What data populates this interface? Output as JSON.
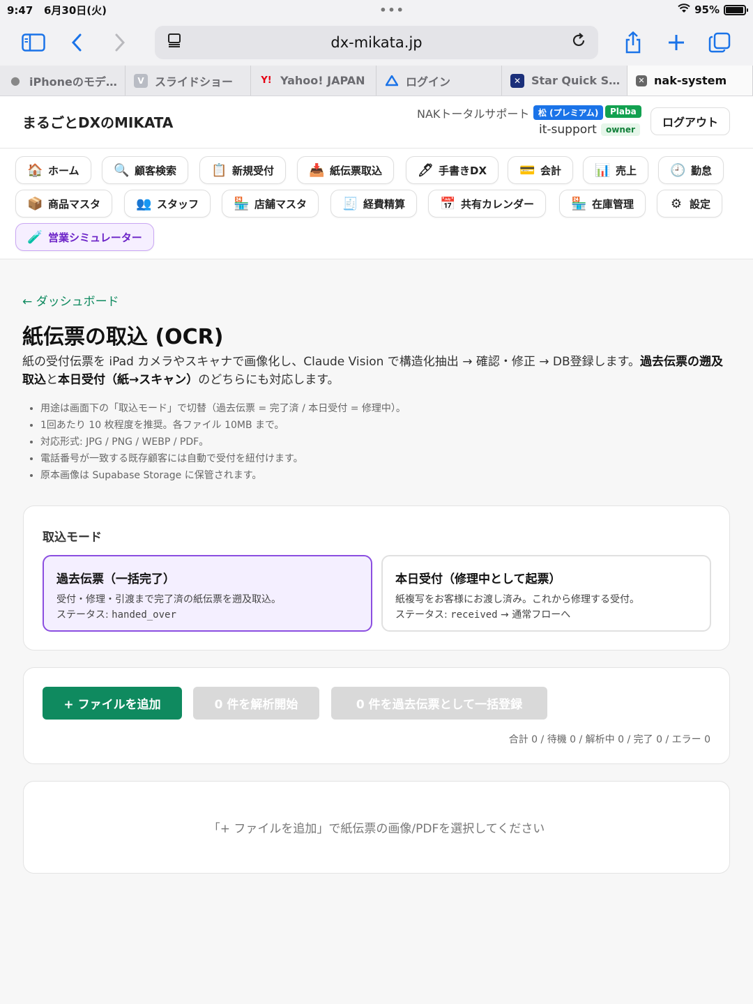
{
  "status_bar": {
    "time": "9:47",
    "date": "6月30日(火)",
    "battery": "95%",
    "battery_level": 0.95
  },
  "browser": {
    "url": "dx-mikata.jp",
    "tabs": [
      {
        "label": "iPhoneのモデ…",
        "icon": "apple-icon"
      },
      {
        "label": "スライドショー",
        "icon": "v-icon"
      },
      {
        "label": "Yahoo! JAPAN",
        "icon": "yahoo-icon"
      },
      {
        "label": "ログイン",
        "icon": "drive-icon"
      },
      {
        "label": "Star Quick S…",
        "icon": "star-icon"
      },
      {
        "label": "nak-system",
        "icon": "close-icon",
        "active": true
      }
    ]
  },
  "header": {
    "brand": "まるごとDXのMIKATA",
    "org": "NAKトータルサポート",
    "plan_badge": "松 (プレミアム)",
    "plaba_badge": "Plaba",
    "user": "it-support",
    "role_badge": "owner",
    "logout": "ログアウト"
  },
  "nav": [
    {
      "label": "ホーム",
      "icon": "🏠"
    },
    {
      "label": "顧客検索",
      "icon": "🔍"
    },
    {
      "label": "新規受付",
      "icon": "📋"
    },
    {
      "label": "紙伝票取込",
      "icon": "📥"
    },
    {
      "label": "手書きDX",
      "icon": "🖊"
    },
    {
      "label": "会計",
      "icon": "💳"
    },
    {
      "label": "売上",
      "icon": "📊"
    },
    {
      "label": "勤怠",
      "icon": "🕘"
    },
    {
      "label": "商品マスタ",
      "icon": "📦"
    },
    {
      "label": "スタッフ",
      "icon": "👥"
    },
    {
      "label": "店舗マスタ",
      "icon": "🏪"
    },
    {
      "label": "経費精算",
      "icon": "🧾"
    },
    {
      "label": "共有カレンダー",
      "icon": "📅"
    },
    {
      "label": "在庫管理",
      "icon": "🏪"
    },
    {
      "label": "設定",
      "icon": "⚙"
    },
    {
      "label": "営業シミュレーター",
      "icon": "🧪"
    }
  ],
  "main": {
    "back_link": "← ダッシュボード",
    "title": "紙伝票の取込 (OCR)",
    "lead_1": "紙の受付伝票を iPad カメラやスキャナで画像化し、Claude Vision で構造化抽出 → 確認・修正 → DB登録します。",
    "lead_2": "過去伝票の遡及取込",
    "lead_3": "と",
    "lead_4": "本日受付（紙→スキャン）",
    "lead_5": "のどちらにも対応します。",
    "notes": [
      "用途は画面下の「取込モード」で切替（過去伝票 = 完了済 / 本日受付 = 修理中）。",
      "1回あたり 10 枚程度を推奨。各ファイル 10MB まで。",
      "対応形式: JPG / PNG / WEBP / PDF。",
      "電話番号が一致する既存顧客には自動で受付を紐付けます。",
      "原本画像は Supabase Storage に保管されます。"
    ]
  },
  "mode": {
    "label": "取込モード",
    "past": {
      "title": "過去伝票（一括完了）",
      "desc": "受付・修理・引渡まで完了済の紙伝票を遡及取込。",
      "status_prefix": "ステータス: ",
      "status_value": "handed_over"
    },
    "today": {
      "title": "本日受付（修理中として起票）",
      "desc": "紙複写をお客様にお渡し済み。これから修理する受付。",
      "status_prefix": "ステータス: ",
      "status_value": "received",
      "status_suffix": " → 通常フローへ"
    }
  },
  "actions": {
    "add_file": "+ ファイルを追加",
    "analyze": "0 件を解析開始",
    "register": "0 件を過去伝票として一括登録",
    "counts": "合計 0 / 待機 0 / 解析中 0 / 完了 0 / エラー 0"
  },
  "empty": {
    "message": "「+ ファイルを追加」で紙伝票の画像/PDFを選択してください"
  },
  "colors": {
    "accent_green": "#0f8a5f",
    "accent_purple": "#8b4ee0",
    "link_blue": "#1a73e8"
  }
}
